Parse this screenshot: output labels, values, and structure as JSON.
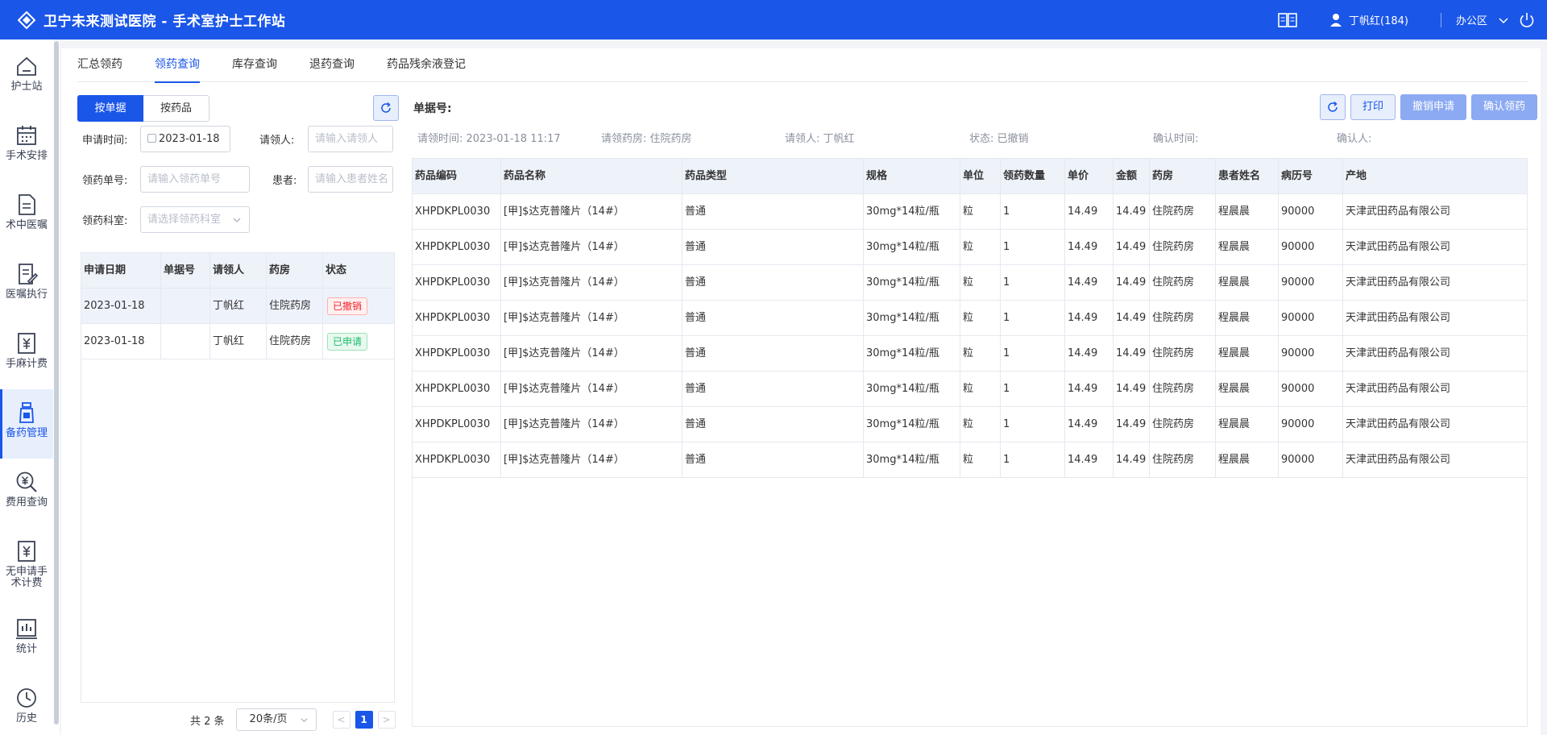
{
  "header": {
    "title": "卫宁未来测试医院 - 手术室护士工作站",
    "user": "丁帆红(184)",
    "area": "办公区"
  },
  "sidebar": {
    "items": [
      {
        "label": "护士站",
        "icon": "home-icon"
      },
      {
        "label": "手术安排",
        "icon": "calendar-icon"
      },
      {
        "label": "术中医嘱",
        "icon": "document-icon"
      },
      {
        "label": "医嘱执行",
        "icon": "edit-doc-icon"
      },
      {
        "label": "手麻计费",
        "icon": "yuan-doc-icon"
      },
      {
        "label": "备药管理",
        "icon": "medicine-bottle-icon"
      },
      {
        "label": "费用查询",
        "icon": "yuan-search-icon"
      },
      {
        "label": "无申请手术计费",
        "icon": "yuan-doc-icon"
      },
      {
        "label": "统计",
        "icon": "bar-chart-icon"
      },
      {
        "label": "历史",
        "icon": "clock-icon"
      }
    ],
    "active_index": 5
  },
  "tabs": [
    "汇总领药",
    "领药查询",
    "库存查询",
    "退药查询",
    "药品残余液登记"
  ],
  "active_tab": 1,
  "left": {
    "seg": {
      "by_order": "按单据",
      "by_drug": "按药品"
    },
    "filters": {
      "apply_time_label": "申请时间:",
      "apply_time_value": "2023-01-18",
      "receiver_label": "请领人:",
      "receiver_placeholder": "请输入请领人",
      "order_no_label": "领药单号:",
      "order_no_placeholder": "请输入领药单号",
      "patient_label": "患者:",
      "patient_placeholder": "请输入患者姓名",
      "dept_label": "领药科室:",
      "dept_placeholder": "请选择领药科室"
    },
    "columns": [
      "申请日期",
      "单据号",
      "请领人",
      "药房",
      "状态"
    ],
    "rows": [
      {
        "date": "2023-01-18",
        "no": "",
        "person": "丁帆红",
        "pharmacy": "住院药房",
        "status": "已撤销",
        "status_type": "red"
      },
      {
        "date": "2023-01-18",
        "no": "",
        "person": "丁帆红",
        "pharmacy": "住院药房",
        "status": "已申请",
        "status_type": "green"
      }
    ],
    "pager": {
      "total": "共 2 条",
      "page_size": "20条/页",
      "prev": "<",
      "current": "1",
      "next": ">"
    }
  },
  "right": {
    "title": "单据号:",
    "buttons": {
      "print": "打印",
      "cancel": "撤销申请",
      "confirm": "确认领药"
    },
    "info": {
      "time": "请领时间: 2023-01-18 11:17",
      "pharmacy": "请领药房: 住院药房",
      "person": "请领人: 丁帆红",
      "status": "状态: 已撤销",
      "confirm_time": "确认时间:",
      "confirm_person": "确认人:"
    },
    "columns": [
      "药品编码",
      "药品名称",
      "药品类型",
      "规格",
      "单位",
      "领药数量",
      "单价",
      "金额",
      "药房",
      "患者姓名",
      "病历号",
      "产地"
    ],
    "rows": [
      [
        "XHPDKPL0030",
        "[甲]$达克普隆片（14#）",
        "普通",
        "30mg*14粒/瓶",
        "粒",
        "1",
        "14.49",
        "14.49",
        "住院药房",
        "程晨晨",
        "90000",
        "天津武田药品有限公司"
      ],
      [
        "XHPDKPL0030",
        "[甲]$达克普隆片（14#）",
        "普通",
        "30mg*14粒/瓶",
        "粒",
        "1",
        "14.49",
        "14.49",
        "住院药房",
        "程晨晨",
        "90000",
        "天津武田药品有限公司"
      ],
      [
        "XHPDKPL0030",
        "[甲]$达克普隆片（14#）",
        "普通",
        "30mg*14粒/瓶",
        "粒",
        "1",
        "14.49",
        "14.49",
        "住院药房",
        "程晨晨",
        "90000",
        "天津武田药品有限公司"
      ],
      [
        "XHPDKPL0030",
        "[甲]$达克普隆片（14#）",
        "普通",
        "30mg*14粒/瓶",
        "粒",
        "1",
        "14.49",
        "14.49",
        "住院药房",
        "程晨晨",
        "90000",
        "天津武田药品有限公司"
      ],
      [
        "XHPDKPL0030",
        "[甲]$达克普隆片（14#）",
        "普通",
        "30mg*14粒/瓶",
        "粒",
        "1",
        "14.49",
        "14.49",
        "住院药房",
        "程晨晨",
        "90000",
        "天津武田药品有限公司"
      ],
      [
        "XHPDKPL0030",
        "[甲]$达克普隆片（14#）",
        "普通",
        "30mg*14粒/瓶",
        "粒",
        "1",
        "14.49",
        "14.49",
        "住院药房",
        "程晨晨",
        "90000",
        "天津武田药品有限公司"
      ],
      [
        "XHPDKPL0030",
        "[甲]$达克普隆片（14#）",
        "普通",
        "30mg*14粒/瓶",
        "粒",
        "1",
        "14.49",
        "14.49",
        "住院药房",
        "程晨晨",
        "90000",
        "天津武田药品有限公司"
      ],
      [
        "XHPDKPL0030",
        "[甲]$达克普隆片（14#）",
        "普通",
        "30mg*14粒/瓶",
        "粒",
        "1",
        "14.49",
        "14.49",
        "住院药房",
        "程晨晨",
        "90000",
        "天津武田药品有限公司"
      ]
    ]
  },
  "colors": {
    "primary": "#1a56e8",
    "disabled_btn": "#8caaf2",
    "danger": "#f5222d",
    "success": "#19be6b"
  }
}
